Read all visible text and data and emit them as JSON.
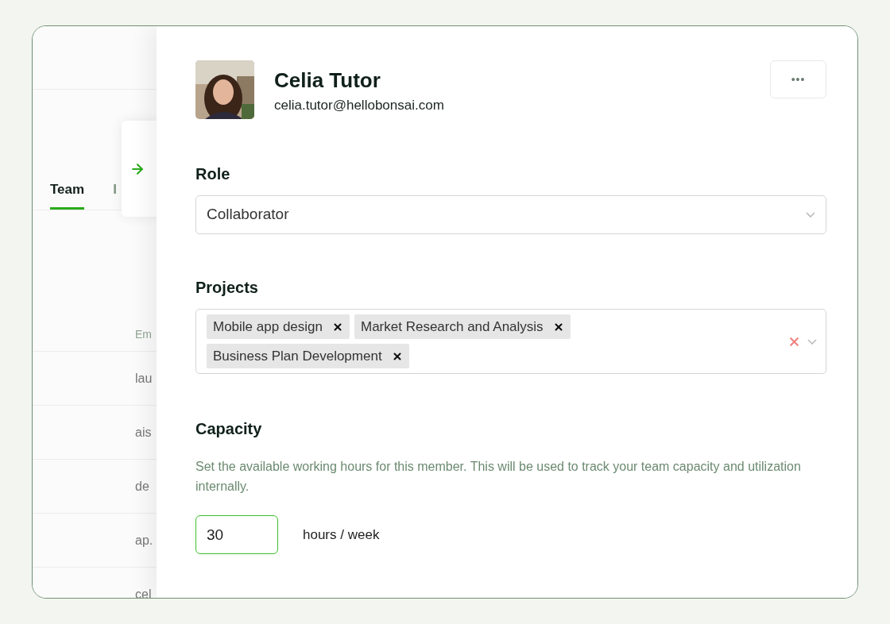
{
  "background": {
    "tabs": [
      {
        "label": "Team",
        "selected": true
      },
      {
        "label": "I",
        "selected": false
      }
    ],
    "column_header": "Em",
    "rows": [
      "lau",
      "ais",
      "de",
      "ap.",
      "cel"
    ]
  },
  "member": {
    "name": "Celia Tutor",
    "email": "celia.tutor@hellobonsai.com",
    "menu_button": "•••"
  },
  "role": {
    "label": "Role",
    "value": "Collaborator"
  },
  "projects": {
    "label": "Projects",
    "tags": [
      "Mobile app design",
      "Market Research and Analysis",
      "Business Plan Development"
    ]
  },
  "capacity": {
    "label": "Capacity",
    "description": "Set the available working hours for this member. This will be used to track your team capacity and utilization internally.",
    "hours": "30",
    "unit": "hours / week"
  }
}
